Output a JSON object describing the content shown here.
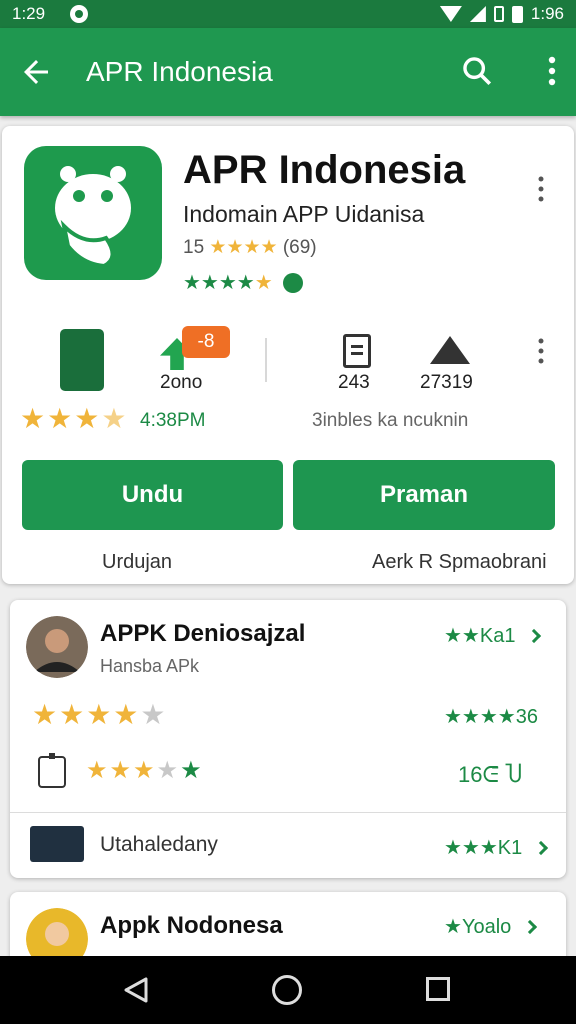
{
  "status": {
    "time": "1:29",
    "time_right": "1:96"
  },
  "appbar": {
    "title": "APR Indonesia",
    "back_icon": "arrow-back-icon",
    "search_icon": "search-icon",
    "more_icon": "more-vert-icon"
  },
  "header": {
    "title": "APR Indonesia",
    "subtitle": "Indomain APP Uidanisa",
    "rating_text": "15",
    "rating_count": "(69)",
    "icon_color": "#1e9a4d"
  },
  "stats": {
    "downloads_value": "2ono",
    "badge": "-8",
    "pages_value": "243",
    "size_value": "27319",
    "time_label": "4:38PM",
    "right_label": "3inbles ka ncuknin"
  },
  "actions": {
    "primary_label": "Undu",
    "secondary_label": "Praman",
    "primary_caption": "Urdujan",
    "secondary_caption": "Aerk R Spmaobrani"
  },
  "list": {
    "item1": {
      "title": "APPK Deniosajzal",
      "subtitle": "Hansba APk",
      "meta": "Ka1",
      "stars_meta": "36",
      "detail_value": "16ᕮ̄ Ⴎ"
    },
    "item2": {
      "label": "Utahaledany",
      "meta": "K1"
    },
    "item3": {
      "title": "Appk Nodonesa",
      "meta": "Yoalo"
    }
  },
  "colors": {
    "primary": "#1f9850",
    "dark": "#1b7a3e",
    "star": "#f0b43a",
    "badge": "#ef6f25"
  }
}
